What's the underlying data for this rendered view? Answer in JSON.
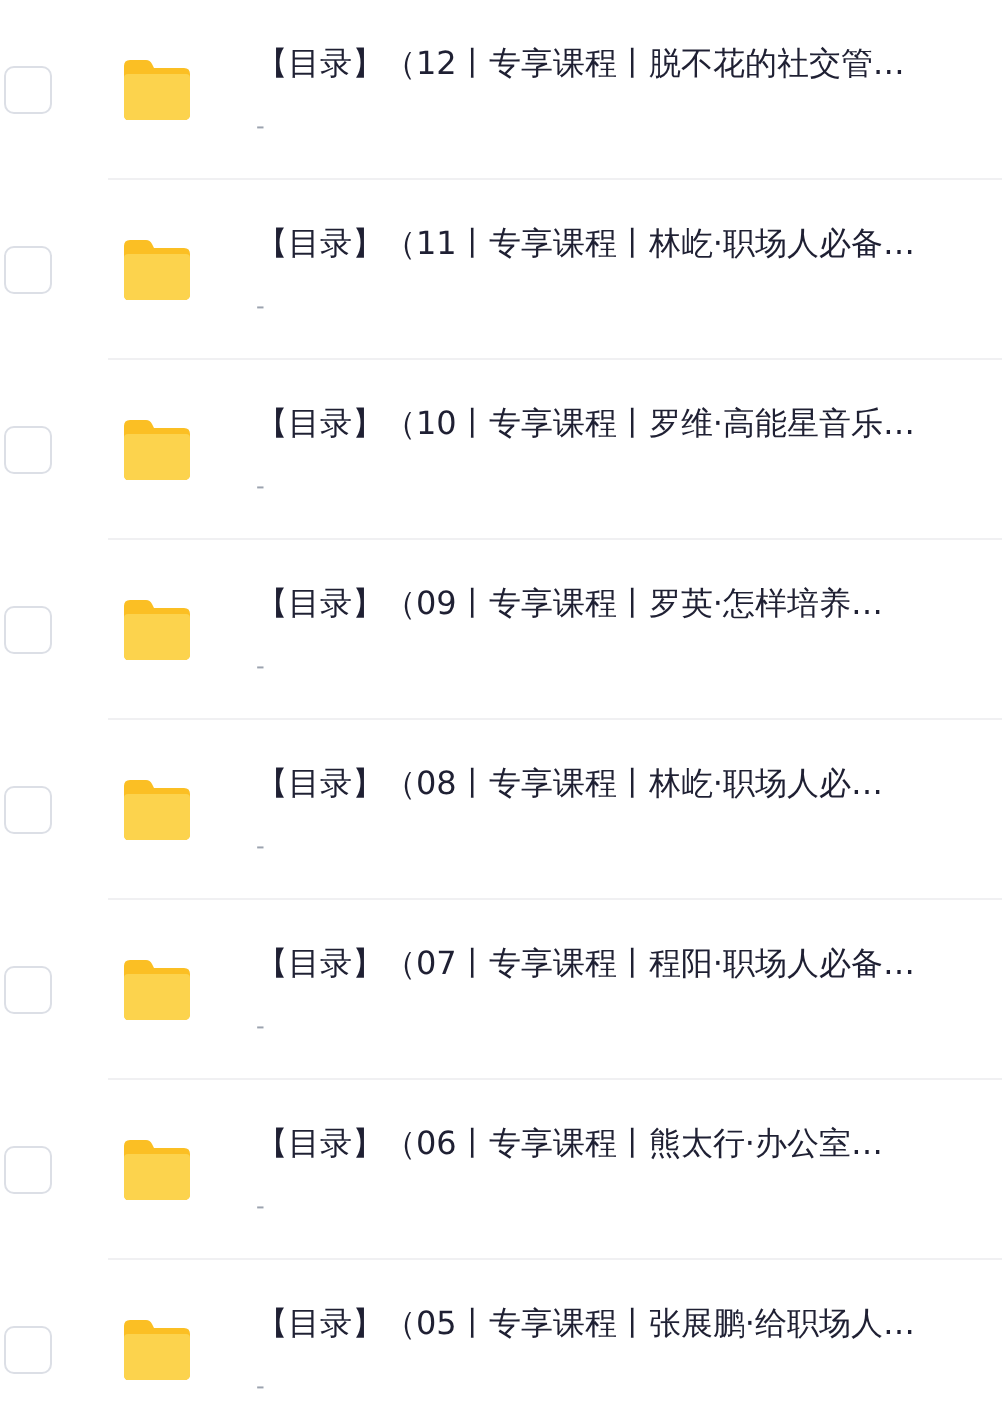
{
  "rows": [
    {
      "title": "【目录】（12丨专享课程丨脱不花的社交管…",
      "subtitle": "-",
      "checked": false
    },
    {
      "title": "【目录】（11丨专享课程丨林屹·职场人必备…",
      "subtitle": "-",
      "checked": false
    },
    {
      "title": "【目录】（10丨专享课程丨罗维·高能星音乐…",
      "subtitle": "-",
      "checked": false
    },
    {
      "title": "【目录】（09丨专享课程丨罗英·怎样培养…",
      "subtitle": "-",
      "checked": false
    },
    {
      "title": "【目录】（08丨专享课程丨林屹·职场人必…",
      "subtitle": "-",
      "checked": false
    },
    {
      "title": "【目录】（07丨专享课程丨程阳·职场人必备…",
      "subtitle": "-",
      "checked": false
    },
    {
      "title": "【目录】（06丨专享课程丨熊太行·办公室…",
      "subtitle": "-",
      "checked": false
    },
    {
      "title": "【目录】（05丨专享课程丨张展鹏·给职场人…",
      "subtitle": "-",
      "checked": false
    }
  ]
}
